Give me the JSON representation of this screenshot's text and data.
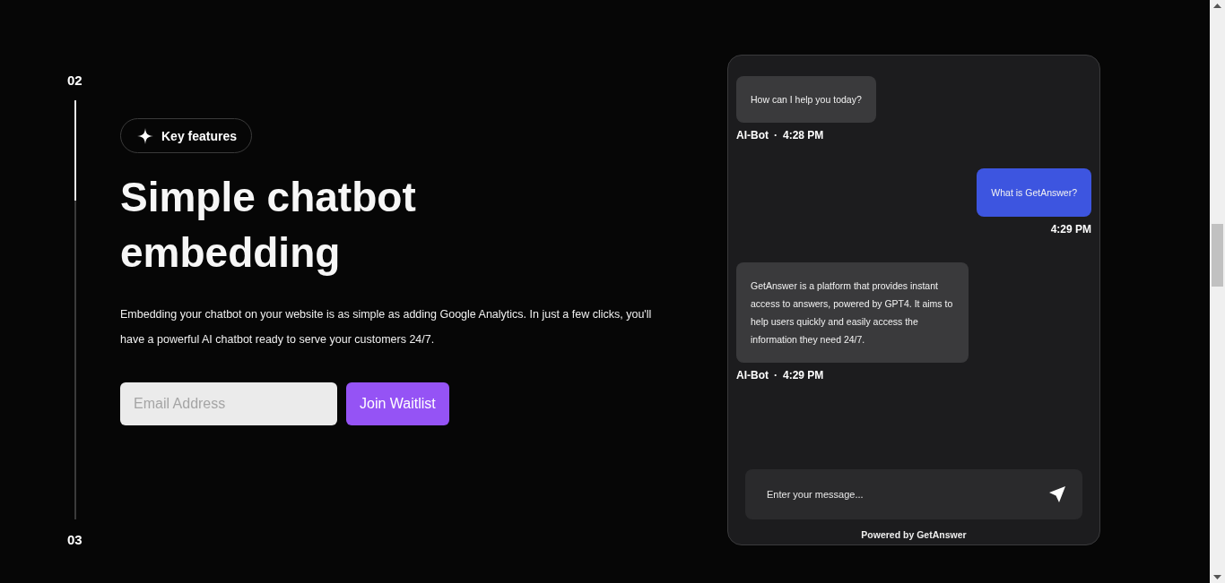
{
  "steps": {
    "current": "02",
    "next": "03",
    "level": 0.24
  },
  "badge": {
    "label": "Key features"
  },
  "heading": "Simple chatbot embedding",
  "description": "Embedding your chatbot on your website is as simple as adding Google Analytics. In just a few clicks, you'll have a powerful AI chatbot ready to serve your customers 24/7.",
  "signup": {
    "placeholder": "Email Address",
    "button": "Join Waitlist"
  },
  "chat": {
    "messages": [
      {
        "kind": "bot",
        "text": "How can I help you today?",
        "sender": "AI-Bot",
        "separator": "·",
        "time": "4:28 PM"
      },
      {
        "kind": "user",
        "text": "What is GetAnswer?",
        "time": "4:29 PM"
      },
      {
        "kind": "bot",
        "text": "GetAnswer is a platform that provides instant access to answers, powered by GPT4. It aims to help users quickly and easily access the information they need 24/7.",
        "sender": "AI-Bot",
        "separator": "·",
        "time": "4:29 PM"
      }
    ],
    "input": {
      "placeholder": "Enter your message..."
    },
    "footer": "Powered by GetAnswer"
  }
}
